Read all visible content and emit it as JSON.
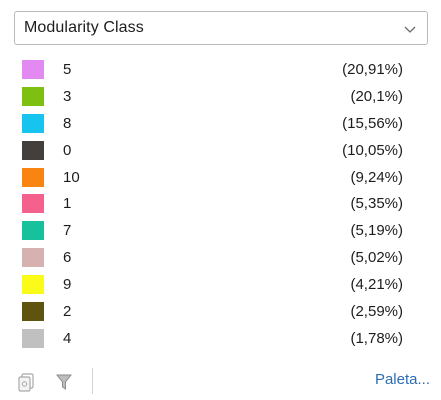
{
  "dropdown": {
    "selected": "Modularity Class"
  },
  "legend": {
    "items": [
      {
        "label": "5",
        "percent": "(20,91%)",
        "color": "#e28af2"
      },
      {
        "label": "3",
        "percent": "(20,1%)",
        "color": "#7dc012"
      },
      {
        "label": "8",
        "percent": "(15,56%)",
        "color": "#17c3ef"
      },
      {
        "label": "0",
        "percent": "(10,05%)",
        "color": "#433f3c"
      },
      {
        "label": "10",
        "percent": "(9,24%)",
        "color": "#fa8411"
      },
      {
        "label": "1",
        "percent": "(5,35%)",
        "color": "#f3618c"
      },
      {
        "label": "7",
        "percent": "(5,19%)",
        "color": "#17c19c"
      },
      {
        "label": "6",
        "percent": "(5,02%)",
        "color": "#d5b2b0"
      },
      {
        "label": "9",
        "percent": "(4,21%)",
        "color": "#fbfb1a"
      },
      {
        "label": "2",
        "percent": "(2,59%)",
        "color": "#5f540f"
      },
      {
        "label": "4",
        "percent": "(1,78%)",
        "color": "#c0c0c0"
      }
    ]
  },
  "footer": {
    "palette_link": "Paleta...",
    "icons": [
      "copy-icon",
      "funnel-icon"
    ]
  }
}
